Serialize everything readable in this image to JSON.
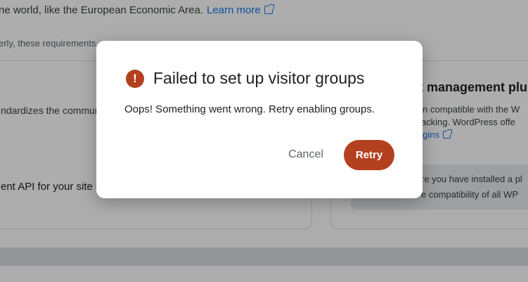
{
  "background": {
    "intro": {
      "text": "ne world, like the European Economic Area.",
      "link": "Learn more"
    },
    "note": "erly, these requirements",
    "left_card": {
      "line1": "ndardizes the commun",
      "line2": "ent API for your site"
    },
    "right_card": {
      "title": "nt management plu",
      "line1": "gin compatible with the W",
      "line2": " tracking. WordPress offe",
      "link": "lugins",
      "info_line1": "re you have installed a pl",
      "info_line2": "e compatibility of all WP"
    }
  },
  "dialog": {
    "icon": "error-icon",
    "title": "Failed to set up visitor groups",
    "message": "Oops! Something went wrong. Retry enabling groups.",
    "cancel_label": "Cancel",
    "retry_label": "Retry"
  },
  "colors": {
    "accent": "#b3411f",
    "link": "#1a73e8"
  }
}
